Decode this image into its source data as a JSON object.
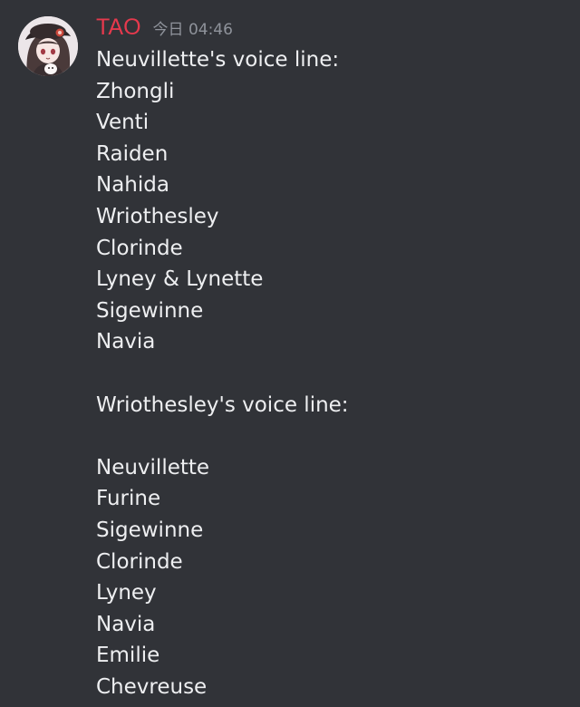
{
  "message": {
    "author": "TAO",
    "timestamp": "今日 04:46",
    "lines": [
      "Neuvillette's voice line:",
      "Zhongli",
      "Venti",
      "Raiden",
      "Nahida",
      "Wriothesley",
      "Clorinde",
      "Lyney & Lynette",
      "Sigewinne",
      "Navia",
      "",
      "Wriothesley's voice line:",
      "",
      "Neuvillette",
      "Furine",
      "Sigewinne",
      "Clorinde",
      "Lyney",
      "Navia",
      "Emilie",
      "Chevreuse"
    ]
  },
  "colors": {
    "background": "#313338",
    "author": "#e5394d",
    "timestamp": "#8f939b",
    "text": "#eeeff1"
  },
  "icons": {
    "avatar": "anime-character-avatar"
  }
}
